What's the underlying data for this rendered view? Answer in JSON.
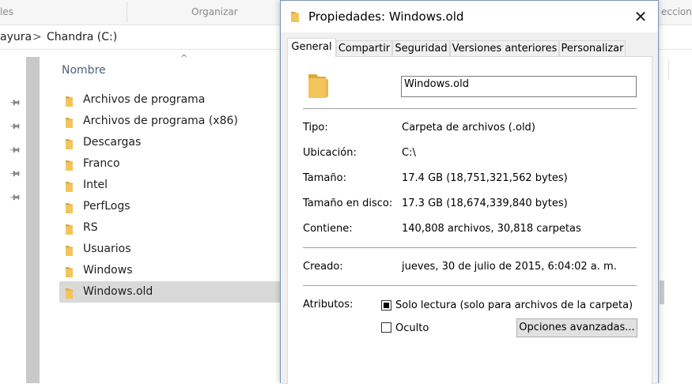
{
  "explorer": {
    "ribbon_left": "les",
    "ribbon_organize": "Organizar",
    "ribbon_right": "ecciona",
    "breadcrumb_part": "ayura",
    "breadcrumb_sep": ">",
    "breadcrumb_current": "Chandra (C:)",
    "column_name": "Nombre",
    "sort_caret": "^",
    "files": [
      {
        "name": "Archivos de programa"
      },
      {
        "name": "Archivos de programa (x86)"
      },
      {
        "name": "Descargas"
      },
      {
        "name": "Franco"
      },
      {
        "name": "Intel"
      },
      {
        "name": "PerfLogs"
      },
      {
        "name": "RS"
      },
      {
        "name": "Usuarios"
      },
      {
        "name": "Windows"
      },
      {
        "name": "Windows.old",
        "selected": true
      }
    ]
  },
  "dialog": {
    "title": "Propiedades: Windows.old",
    "close_glyph": "✕",
    "tabs": [
      "General",
      "Compartir",
      "Seguridad",
      "Versiones anteriores",
      "Personalizar"
    ],
    "active_tab": "General",
    "name_value": "Windows.old",
    "fields": {
      "tipo_label": "Tipo:",
      "tipo_value": "Carpeta de archivos (.old)",
      "ubicacion_label": "Ubicación:",
      "ubicacion_value": "C:\\",
      "tamano_label": "Tamaño:",
      "tamano_value": "17.4 GB (18,751,321,562 bytes)",
      "tamano_disco_label": "Tamaño en disco:",
      "tamano_disco_value": "17.3 GB (18,674,339,840 bytes)",
      "contiene_label": "Contiene:",
      "contiene_value": "140,808 archivos, 30,818 carpetas",
      "creado_label": "Creado:",
      "creado_value": "jueves, 30 de julio de 2015, 6:04:02 a. m.",
      "atributos_label": "Atributos:"
    },
    "attributes": {
      "solo_lectura_label": "Solo lectura (solo para archivos de la carpeta)",
      "solo_lectura_state": "indeterminate",
      "oculto_label": "Oculto",
      "oculto_checked": false,
      "advanced_button": "Opciones avanzadas..."
    }
  },
  "colors": {
    "folder": "#f2c55c",
    "folder_dark": "#dcaa3a",
    "selection": "#d9d9d9",
    "dialog_border": "#7a96b9",
    "column_header": "#4c607a"
  }
}
